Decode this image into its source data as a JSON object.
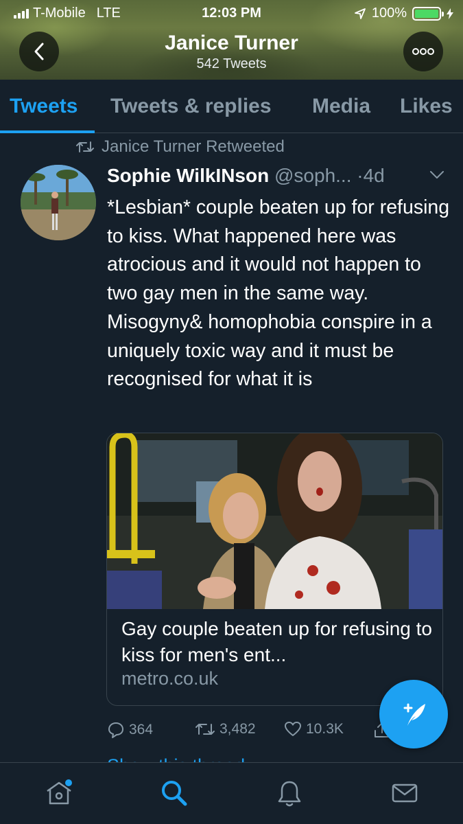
{
  "status_bar": {
    "carrier": "T-Mobile",
    "network": "LTE",
    "time": "12:03 PM",
    "battery": "100%"
  },
  "header": {
    "name": "Janice Turner",
    "tweet_count": "542 Tweets",
    "back_icon": "chevron-left-icon",
    "more_icon": "more-dots-icon"
  },
  "tabs": [
    {
      "label": "Tweets",
      "active": true
    },
    {
      "label": "Tweets & replies",
      "active": false
    },
    {
      "label": "Media",
      "active": false
    },
    {
      "label": "Likes",
      "active": false
    }
  ],
  "tweet": {
    "retweeted_by": "Janice Turner Retweeted",
    "author_name": "Sophie WilkINson",
    "author_handle": "@soph...",
    "time": "·4d",
    "text": "*Lesbian* couple beaten up for refusing to kiss. What happened here was atrocious and it would not happen to two gay men in the same way. Misogyny& homophobia conspire in a uniquely toxic way and it must be recognised for what it is",
    "card": {
      "title": "Gay couple beaten up for refusing to kiss for men's ent...",
      "domain": "metro.co.uk"
    },
    "replies": "364",
    "retweets": "3,482",
    "likes": "10.3K"
  },
  "show_thread": "Show this thread",
  "bottom_nav": [
    "home-icon",
    "search-icon",
    "notifications-icon",
    "messages-icon"
  ],
  "colors": {
    "background": "#15202b",
    "accent": "#1da1f2",
    "secondary_text": "#8899a6",
    "border": "#38444d"
  }
}
